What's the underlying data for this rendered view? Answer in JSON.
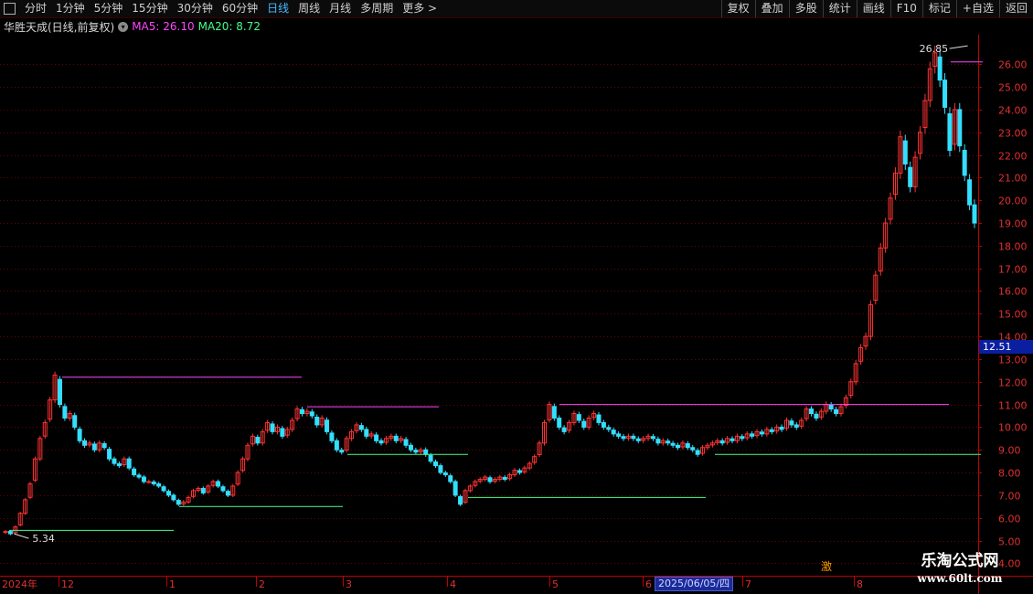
{
  "toolbar": {
    "periods": [
      "分时",
      "1分钟",
      "5分钟",
      "15分钟",
      "30分钟",
      "60分钟",
      "日线",
      "周线",
      "月线",
      "多周期",
      "更多"
    ],
    "active_period": "日线",
    "actions": [
      "复权",
      "叠加",
      "多股",
      "统计",
      "画线",
      "F10",
      "标记",
      "+自选",
      "返回"
    ]
  },
  "info": {
    "stock": "华胜天成(日线,前复权)",
    "ma5_label": "MA5: 26.10",
    "ma20_label": "MA20: 8.72",
    "ma5_color": "#ff44ff",
    "ma20_color": "#44ff88"
  },
  "annotations": {
    "high": "26.85",
    "low": "5.34",
    "current_price": "12.51",
    "date_tag": "2025/06/05/四",
    "marker_icon": "激"
  },
  "colors": {
    "up": "#ff3333",
    "down": "#33dfff",
    "grid": "#6a0000",
    "axis": "#c00000"
  },
  "chart_data": {
    "type": "candlestick",
    "y_ticks": [
      4.0,
      5.0,
      6.0,
      7.0,
      8.0,
      9.0,
      10.0,
      11.0,
      12.0,
      13.0,
      14.0,
      15.0,
      16.0,
      17.0,
      18.0,
      19.0,
      20.0,
      21.0,
      22.0,
      23.0,
      24.0,
      25.0,
      26.0
    ],
    "ylim": [
      3.45,
      27.3
    ],
    "x_labels": [
      "2024年",
      "12",
      "1",
      "2",
      "3",
      "4",
      "5",
      "6",
      "7",
      "8"
    ],
    "closes": [
      5.4,
      5.3,
      5.6,
      6.2,
      6.8,
      7.5,
      8.6,
      9.5,
      10.2,
      11.2,
      12.3,
      11.0,
      10.4,
      10.6,
      10.0,
      9.4,
      9.2,
      9.3,
      9.0,
      9.3,
      9.1,
      8.6,
      8.4,
      8.3,
      8.6,
      8.2,
      7.9,
      7.8,
      7.6,
      7.6,
      7.5,
      7.4,
      7.2,
      7.0,
      6.8,
      6.6,
      6.7,
      6.9,
      7.2,
      7.3,
      7.1,
      7.4,
      7.6,
      7.4,
      7.2,
      7.0,
      7.4,
      8.0,
      8.6,
      9.2,
      9.6,
      9.3,
      9.8,
      10.2,
      9.8,
      10.0,
      9.6,
      9.9,
      10.3,
      10.8,
      10.6,
      10.7,
      10.5,
      10.1,
      10.4,
      9.8,
      9.4,
      9.0,
      8.9,
      9.5,
      9.8,
      10.1,
      9.9,
      9.6,
      9.7,
      9.4,
      9.3,
      9.5,
      9.6,
      9.4,
      9.5,
      9.2,
      9.0,
      8.9,
      9.0,
      8.8,
      8.5,
      8.3,
      8.0,
      7.9,
      7.6,
      7.0,
      6.6,
      7.2,
      7.4,
      7.6,
      7.7,
      7.8,
      7.6,
      7.7,
      7.8,
      7.7,
      7.9,
      8.1,
      8.0,
      8.2,
      8.4,
      8.7,
      9.3,
      10.2,
      11.0,
      10.4,
      10.0,
      9.8,
      10.2,
      10.6,
      10.3,
      10.0,
      10.4,
      10.6,
      10.2,
      10.0,
      9.9,
      9.7,
      9.6,
      9.5,
      9.6,
      9.5,
      9.4,
      9.5,
      9.6,
      9.5,
      9.3,
      9.4,
      9.3,
      9.2,
      9.1,
      9.3,
      9.1,
      9.0,
      8.8,
      9.1,
      9.2,
      9.3,
      9.4,
      9.3,
      9.5,
      9.4,
      9.6,
      9.5,
      9.7,
      9.6,
      9.8,
      9.7,
      9.9,
      9.8,
      10.0,
      9.9,
      10.3,
      10.1,
      10.0,
      10.3,
      10.8,
      10.6,
      10.4,
      10.7,
      11.0,
      10.8,
      10.6,
      10.9,
      11.3,
      12.0,
      12.8,
      13.5,
      14.0,
      15.4,
      16.7,
      17.9,
      19.0,
      20.1,
      21.2,
      22.8,
      21.6,
      20.6,
      21.9,
      23.0,
      24.4,
      25.8,
      26.5,
      25.3,
      24.1,
      22.2,
      24.0,
      22.4,
      21.1,
      19.8,
      19.0
    ]
  }
}
